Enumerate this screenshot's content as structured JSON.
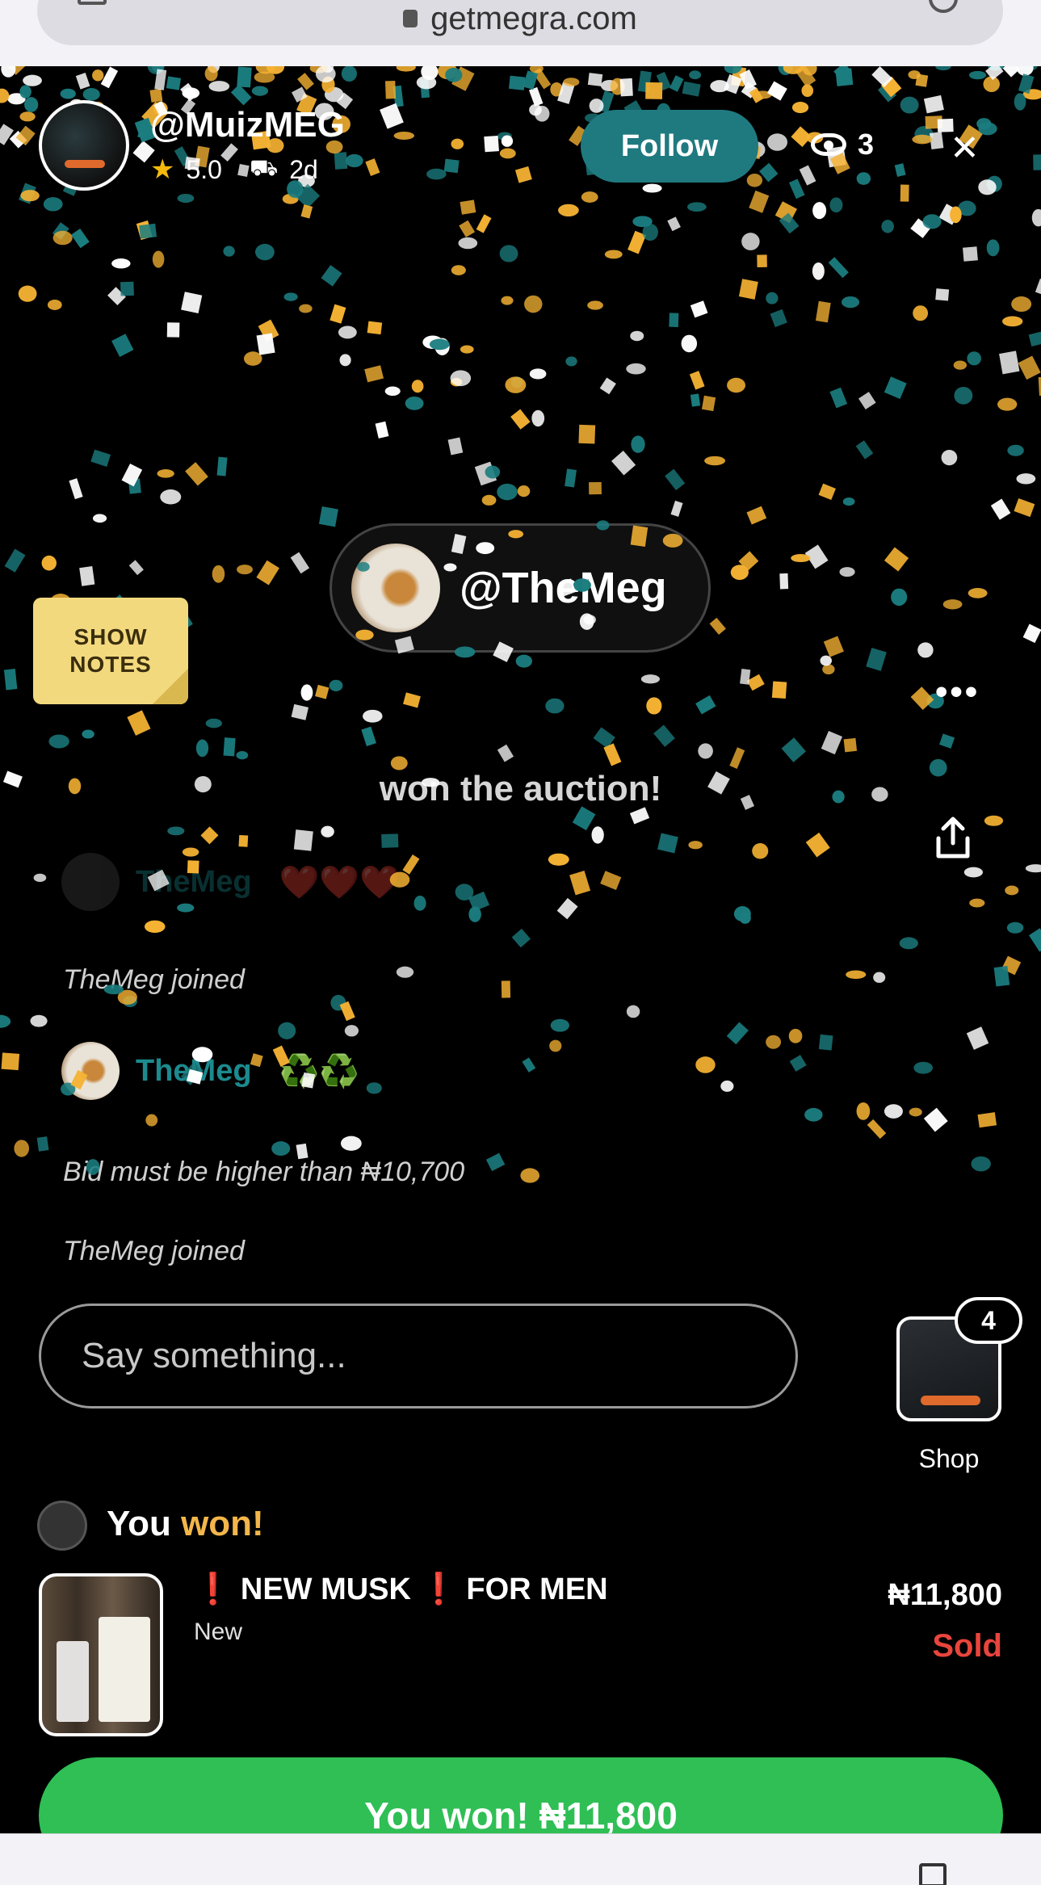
{
  "browser": {
    "url": "getmegra.com"
  },
  "header": {
    "host_name": "@MuizMEG",
    "rating": "5.0",
    "shipping_time": "2d",
    "follow_label": "Follow",
    "viewer_count": "3",
    "icons": [
      "star-icon",
      "truck-icon",
      "eye-icon",
      "close-icon"
    ]
  },
  "winner": {
    "name": "@TheMeg",
    "caption": "won the auction!"
  },
  "notes_button": {
    "line1": "SHOW",
    "line2": "NOTES"
  },
  "chat": [
    {
      "type": "message",
      "user": "TheMeg",
      "text": "❤️❤️❤️"
    },
    {
      "type": "system",
      "text": "TheMeg joined"
    },
    {
      "type": "message",
      "user": "TheMeg",
      "text": "♻️♻️"
    },
    {
      "type": "system",
      "text": "Bid must be higher than ₦10,700"
    },
    {
      "type": "system",
      "text": "TheMeg joined"
    }
  ],
  "input": {
    "placeholder": "Say something..."
  },
  "shop": {
    "badge_count": "4",
    "label": "Shop"
  },
  "won_status": {
    "you": "You",
    "won": "won!"
  },
  "product": {
    "title": "❗ NEW MUSK ❗ FOR MEN",
    "condition": "New",
    "price": "₦11,800",
    "status": "Sold"
  },
  "cta": {
    "label": "You won! ₦11,800"
  },
  "colors": {
    "accent_teal": "#1f7a80",
    "won_yellow": "#f3b64a",
    "sold_red": "#e8453c",
    "cta_green": "#2fbf55",
    "confetti": [
      "#f5b233",
      "#1b7d80",
      "#ffffff"
    ]
  }
}
